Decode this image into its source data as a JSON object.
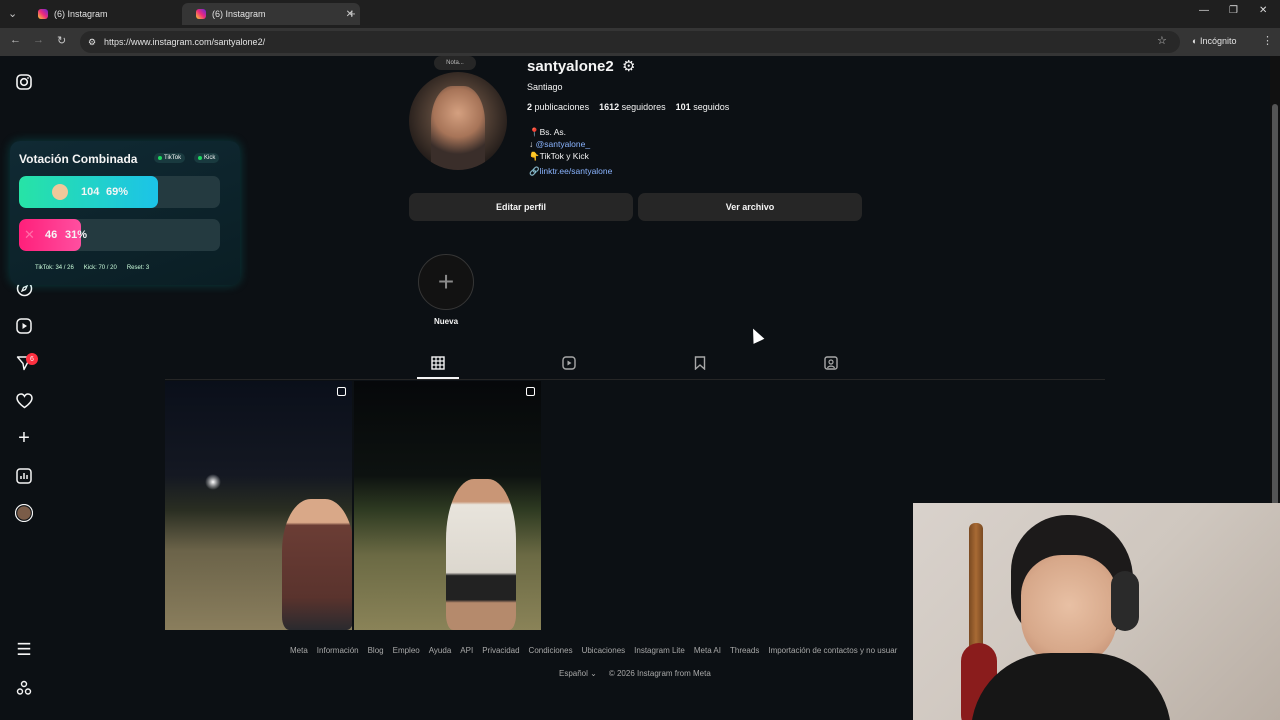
{
  "browser": {
    "tabs": [
      {
        "label": "(6) Instagram",
        "active": false
      },
      {
        "label": "(6) Instagram",
        "active": true
      }
    ],
    "url": "https://www.instagram.com/santyalone2/",
    "incognito_label": "Incógnito"
  },
  "sidebar": {
    "icons": [
      "instagram-icon",
      "home-icon",
      "search-icon",
      "explore-icon",
      "reels-icon",
      "messages-icon",
      "notifications-icon",
      "create-icon",
      "dashboard-icon",
      "profile-icon",
      "more-icon",
      "meta-apps-icon"
    ],
    "messages_badge": "6"
  },
  "vote_widget": {
    "title": "Votación Combinada",
    "tiktok_label": "TikTok",
    "kick_label": "Kick",
    "option_a": {
      "count": "104",
      "percent": "69%",
      "share": 0.69
    },
    "option_b": {
      "count": "46",
      "percent": "31%",
      "share": 0.31
    },
    "footer": {
      "tiktok": "TikTok: 34 / 26",
      "kick": "Kick: 70 / 20",
      "reset": "Reset: 3"
    }
  },
  "profile": {
    "note_label": "Nota...",
    "username": "santyalone2",
    "name": "Santiago",
    "posts": "2",
    "posts_label": "publicaciones",
    "followers": "1612",
    "followers_label": "seguidores",
    "following": "101",
    "following_label": "seguidos",
    "bio_lines": [
      "Bs. As.",
      "@santyalone_",
      "TikTok y Kick"
    ],
    "link": "linktr.ee/santyalone",
    "edit_button": "Editar perfil",
    "archive_button": "Ver archivo",
    "highlight_label": "Nueva"
  },
  "tabs": [
    "posts-tab",
    "reels-tab",
    "saved-tab",
    "tagged-tab"
  ],
  "footer": {
    "links": [
      "Meta",
      "Información",
      "Blog",
      "Empleo",
      "Ayuda",
      "API",
      "Privacidad",
      "Condiciones",
      "Ubicaciones",
      "Instagram Lite",
      "Meta AI",
      "Threads",
      "Importación de contactos y no usuar"
    ],
    "language": "Español",
    "copyright": "© 2026 Instagram from Meta"
  },
  "colors": {
    "background": "#0c1014",
    "link": "#8ab4ff",
    "button": "#262626",
    "vote_green": "#27e3a6",
    "vote_pink": "#ff1f7a"
  }
}
